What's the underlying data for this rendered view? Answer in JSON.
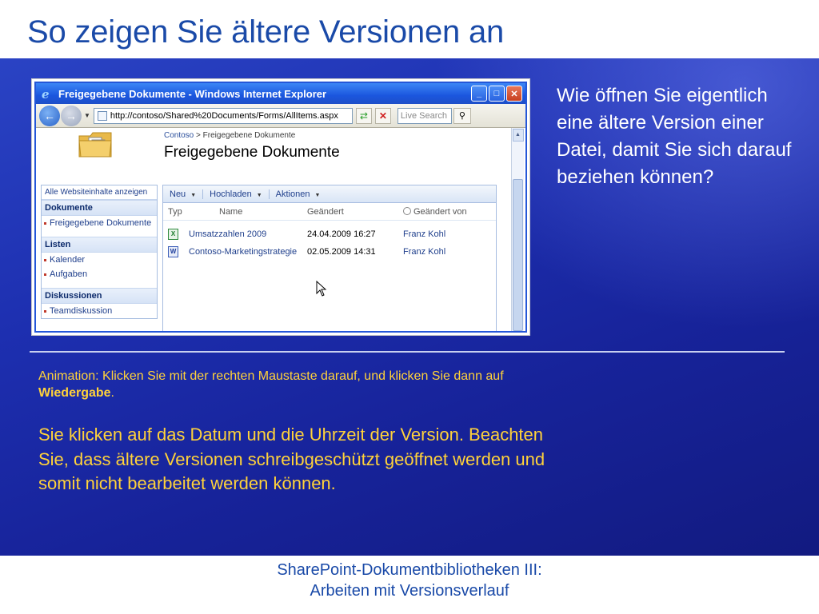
{
  "slide": {
    "title": "So zeigen Sie ältere Versionen an",
    "question": "Wie öffnen Sie eigentlich eine ältere Version einer Datei, damit Sie sich darauf beziehen können?",
    "animation_prefix": "Animation: Klicken Sie mit der rechten Maustaste darauf, und klicken Sie dann auf ",
    "animation_bold": "Wiedergabe",
    "animation_suffix": ".",
    "body": "Sie klicken auf das Datum und die Uhrzeit der Version. Beachten Sie, dass ältere Versionen schreibgeschützt geöffnet werden und somit nicht bearbeitet werden können.",
    "footer_line1": "SharePoint-Dokumentbibliotheken III:",
    "footer_line2": "Arbeiten mit Versionsverlauf",
    "colors": {
      "title": "#1a4aa8",
      "panel": "#1d2fb0",
      "yellow_text": "#ffd23a"
    }
  },
  "browser": {
    "window_title": "Freigegebene Dokumente - Windows Internet Explorer",
    "url": "http://contoso/Shared%20Documents/Forms/AllItems.aspx",
    "search_placeholder": "Live Search",
    "breadcrumb_site": "Contoso",
    "breadcrumb_sep": ">",
    "breadcrumb_page": "Freigegebene Dokumente",
    "page_title": "Freigegebene Dokumente",
    "quicklaunch": {
      "all_content": "Alle Websiteinhalte anzeigen",
      "sections": [
        {
          "heading": "Dokumente",
          "items": [
            "Freigegebene Dokumente"
          ]
        },
        {
          "heading": "Listen",
          "items": [
            "Kalender",
            "Aufgaben"
          ]
        },
        {
          "heading": "Diskussionen",
          "items": [
            "Teamdiskussion"
          ]
        }
      ]
    },
    "toolbar": {
      "new": "Neu",
      "upload": "Hochladen",
      "actions": "Aktionen"
    },
    "columns": {
      "type": "Typ",
      "name": "Name",
      "modified": "Geändert",
      "modified_by": "Geändert von"
    },
    "rows": [
      {
        "icon": "excel-file-icon",
        "name": "Umsatzzahlen 2009",
        "modified": "24.04.2009 16:27",
        "modified_by": "Franz Kohl"
      },
      {
        "icon": "word-file-icon",
        "name": "Contoso-Marketingstrategie",
        "modified": "02.05.2009 14:31",
        "modified_by": "Franz Kohl"
      }
    ]
  }
}
